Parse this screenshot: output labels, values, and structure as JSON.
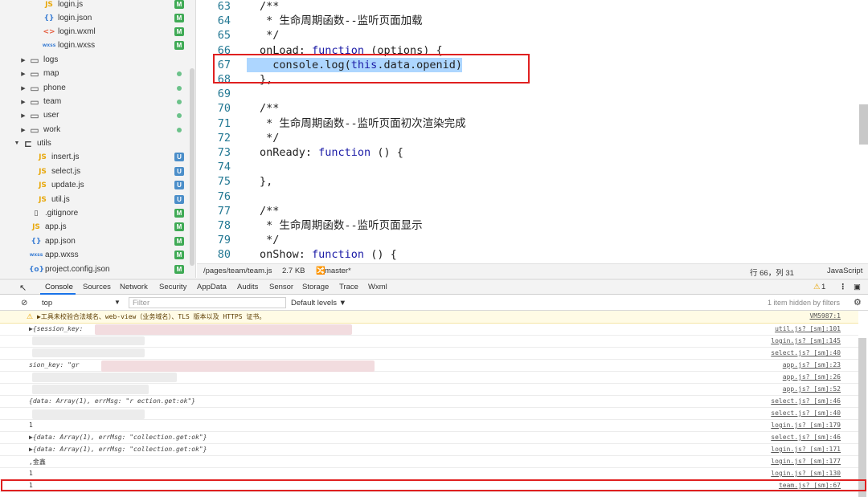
{
  "file_tree": {
    "items": [
      {
        "label": "login.js",
        "icon": "js-file-icon",
        "badge": "M",
        "partial": true
      },
      {
        "label": "login.json",
        "icon": "json-file-icon",
        "badge": "M"
      },
      {
        "label": "login.wxml",
        "icon": "wxml-file-icon",
        "badge": "M"
      },
      {
        "label": "login.wxss",
        "icon": "wxss-file-icon",
        "badge": "M"
      },
      {
        "label": "logs",
        "icon": "folder-icon",
        "badge": ""
      },
      {
        "label": "map",
        "icon": "folder-icon",
        "badge": "dot"
      },
      {
        "label": "phone",
        "icon": "folder-icon",
        "badge": "dot"
      },
      {
        "label": "team",
        "icon": "folder-icon",
        "badge": "dot"
      },
      {
        "label": "user",
        "icon": "folder-icon",
        "badge": "dot"
      },
      {
        "label": "work",
        "icon": "folder-icon",
        "badge": "dot"
      },
      {
        "label": "utils",
        "icon": "folder-open-icon",
        "badge": ""
      },
      {
        "label": "insert.js",
        "icon": "js-file-icon",
        "badge": "U"
      },
      {
        "label": "select.js",
        "icon": "js-file-icon",
        "badge": "U"
      },
      {
        "label": "update.js",
        "icon": "js-file-icon",
        "badge": "U"
      },
      {
        "label": "util.js",
        "icon": "js-file-icon",
        "badge": "U"
      },
      {
        "label": ".gitignore",
        "icon": "file-icon",
        "badge": "M"
      },
      {
        "label": "app.js",
        "icon": "js-file-icon",
        "badge": "M"
      },
      {
        "label": "app.json",
        "icon": "json-file-icon",
        "badge": "M"
      },
      {
        "label": "app.wxss",
        "icon": "wxss-file-icon",
        "badge": "M"
      },
      {
        "label": "project.config.json",
        "icon": "config-file-icon",
        "badge": "M"
      }
    ]
  },
  "editor": {
    "lines": [
      {
        "n": "63",
        "text": "/**"
      },
      {
        "n": "64",
        "text": " * 生命周期函数--监听页面加载"
      },
      {
        "n": "65",
        "text": " */"
      },
      {
        "n": "66",
        "text": "onLoad: function (options) {"
      },
      {
        "n": "67",
        "text": "  console.log(this.data.openid)"
      },
      {
        "n": "68",
        "text": "},"
      },
      {
        "n": "69",
        "text": ""
      },
      {
        "n": "70",
        "text": "/**"
      },
      {
        "n": "71",
        "text": " * 生命周期函数--监听页面初次渲染完成"
      },
      {
        "n": "72",
        "text": " */"
      },
      {
        "n": "73",
        "text": "onReady: function () {"
      },
      {
        "n": "74",
        "text": ""
      },
      {
        "n": "75",
        "text": "},"
      },
      {
        "n": "76",
        "text": ""
      },
      {
        "n": "77",
        "text": "/**"
      },
      {
        "n": "78",
        "text": " * 生命周期函数--监听页面显示"
      },
      {
        "n": "79",
        "text": " */"
      },
      {
        "n": "80",
        "text": "onShow: function () {"
      }
    ]
  },
  "status_bar": {
    "path": "/pages/team/team.js",
    "size": "2.7 KB",
    "branch": "master*",
    "cursor": "行 66，列 31",
    "language": "JavaScript"
  },
  "devtools": {
    "tabs": [
      "Console",
      "Sources",
      "Network",
      "Security",
      "AppData",
      "Audits",
      "Sensor",
      "Storage",
      "Trace",
      "Wxml"
    ],
    "warning_count": "1",
    "context": "top",
    "filter_placeholder": "Filter",
    "levels": "Default levels ▼",
    "hidden_note": "1 item hidden by filters"
  },
  "console": {
    "rows": [
      {
        "msg": "▶工具未校验合法域名、web-view（业务域名）、TLS 版本以及 HTTPS 证书。",
        "src": "VM5987:1",
        "type": "warn"
      },
      {
        "msg": "▶{session_key:",
        "src": "util.js? [sm]:101",
        "type": "obj"
      },
      {
        "msg": "",
        "src": "login.js? [sm]:145",
        "type": "plain"
      },
      {
        "msg": "",
        "src": "select.js? [sm]:40",
        "type": "plain"
      },
      {
        "msg": "sion_key: \"gr",
        "src": "app.js? [sm]:23",
        "type": "obj"
      },
      {
        "msg": "",
        "src": "app.js? [sm]:26",
        "type": "plain"
      },
      {
        "msg": "",
        "src": "app.js? [sm]:52",
        "type": "plain"
      },
      {
        "msg": "{data: Array(1), errMsg: \"r  ection.get:ok\"}",
        "src": "select.js? [sm]:46",
        "type": "obj"
      },
      {
        "msg": "",
        "src": "select.js? [sm]:40",
        "type": "plain"
      },
      {
        "msg": "1",
        "src": "login.js? [sm]:179",
        "type": "plain"
      },
      {
        "msg": "▶{data: Array(1), errMsg: \"collection.get:ok\"}",
        "src": "select.js? [sm]:46",
        "type": "obj"
      },
      {
        "msg": "▶{data: Array(1), errMsg: \"collection.get:ok\"}",
        "src": "login.js? [sm]:171",
        "type": "obj"
      },
      {
        "msg": ",金鑫",
        "src": "login.js? [sm]:177",
        "type": "plain"
      },
      {
        "msg": "1",
        "src": "login.js? [sm]:130",
        "type": "plain"
      },
      {
        "msg": "1",
        "src": "team.js? [sm]:67",
        "type": "plain"
      }
    ]
  },
  "colors": {
    "highlight_frame": "#e02020",
    "selection": "#add6ff",
    "comment": "#2a8b2a",
    "keyword": "#1a1aa6",
    "badge_modified": "#3faa55",
    "badge_untracked": "#4b8ec9"
  }
}
